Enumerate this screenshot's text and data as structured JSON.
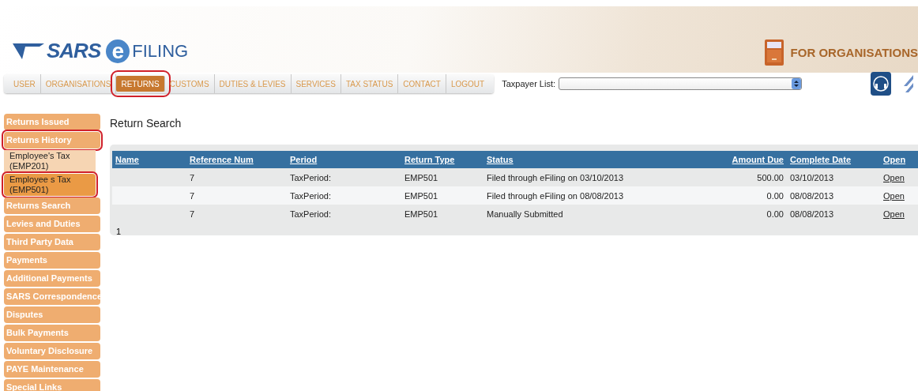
{
  "header": {
    "logo_left": "SARS",
    "logo_mark": "e",
    "logo_right": "FILING",
    "section_title": "FOR ORGANISATIONS"
  },
  "nav": [
    {
      "label": "USER",
      "selected": false,
      "annotated": false
    },
    {
      "label": "ORGANISATIONS",
      "selected": false,
      "annotated": false
    },
    {
      "label": "RETURNS",
      "selected": true,
      "annotated": true
    },
    {
      "label": "CUSTOMS",
      "selected": false,
      "annotated": false
    },
    {
      "label": "DUTIES & LEVIES",
      "selected": false,
      "annotated": false
    },
    {
      "label": "SERVICES",
      "selected": false,
      "annotated": false
    },
    {
      "label": "TAX STATUS",
      "selected": false,
      "annotated": false
    },
    {
      "label": "CONTACT",
      "selected": false,
      "annotated": false
    },
    {
      "label": "LOGOUT",
      "selected": false,
      "annotated": false
    }
  ],
  "taxpayer_list": {
    "label": "Taxpayer List:"
  },
  "sidebar": [
    {
      "label": "Returns Issued",
      "kind": "item",
      "selected": false,
      "annotated": false
    },
    {
      "label": "Returns History",
      "kind": "item",
      "selected": false,
      "annotated": true
    },
    {
      "label": "Employee's Tax (EMP201)",
      "kind": "sub",
      "selected": false,
      "annotated": false
    },
    {
      "label": "Employee s Tax (EMP501)",
      "kind": "sub",
      "selected": true,
      "annotated": true
    },
    {
      "label": "Returns Search",
      "kind": "item",
      "selected": false,
      "annotated": false
    },
    {
      "label": "Levies and Duties",
      "kind": "item",
      "selected": false,
      "annotated": false
    },
    {
      "label": "Third Party Data",
      "kind": "item",
      "selected": false,
      "annotated": false
    },
    {
      "label": "Payments",
      "kind": "item",
      "selected": false,
      "annotated": false
    },
    {
      "label": "Additional Payments",
      "kind": "item",
      "selected": false,
      "annotated": false
    },
    {
      "label": "SARS Correspondence",
      "kind": "item",
      "selected": false,
      "annotated": false
    },
    {
      "label": "Disputes",
      "kind": "item",
      "selected": false,
      "annotated": false
    },
    {
      "label": "Bulk Payments",
      "kind": "item",
      "selected": false,
      "annotated": false
    },
    {
      "label": "Voluntary Disclosure",
      "kind": "item",
      "selected": false,
      "annotated": false
    },
    {
      "label": "PAYE Maintenance",
      "kind": "item",
      "selected": false,
      "annotated": false
    },
    {
      "label": "Special Links",
      "kind": "item",
      "selected": false,
      "annotated": false
    }
  ],
  "page_title": "Return Search",
  "table": {
    "columns": [
      "Name",
      "Reference Num",
      "Period",
      "Return Type",
      "Status",
      "Amount Due",
      "Complete Date",
      "Open"
    ],
    "rows": [
      {
        "reference": "7",
        "period": "TaxPeriod:",
        "return_type": "EMP501",
        "status": "Filed through eFiling on 03/10/2013",
        "amount_due": "500.00",
        "complete_date": "03/10/2013",
        "open": "Open"
      },
      {
        "reference": "7",
        "period": "TaxPeriod:",
        "return_type": "EMP501",
        "status": "Filed through eFiling on 08/08/2013",
        "amount_due": "0.00",
        "complete_date": "08/08/2013",
        "open": "Open"
      },
      {
        "reference": "7",
        "period": "TaxPeriod:",
        "return_type": "EMP501",
        "status": "Manually Submitted",
        "amount_due": "0.00",
        "complete_date": "08/08/2013",
        "open": "Open"
      }
    ],
    "pager": "1"
  }
}
